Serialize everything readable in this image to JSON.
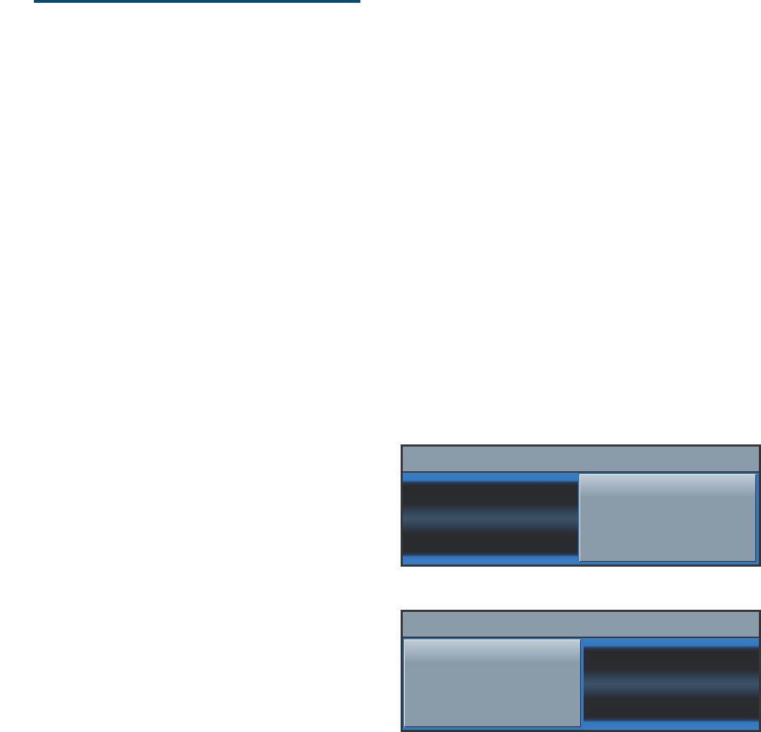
{
  "toggles": [
    {
      "segments": [
        {
          "selected": false
        },
        {
          "selected": true
        }
      ]
    },
    {
      "segments": [
        {
          "selected": true
        },
        {
          "selected": false
        }
      ]
    }
  ]
}
